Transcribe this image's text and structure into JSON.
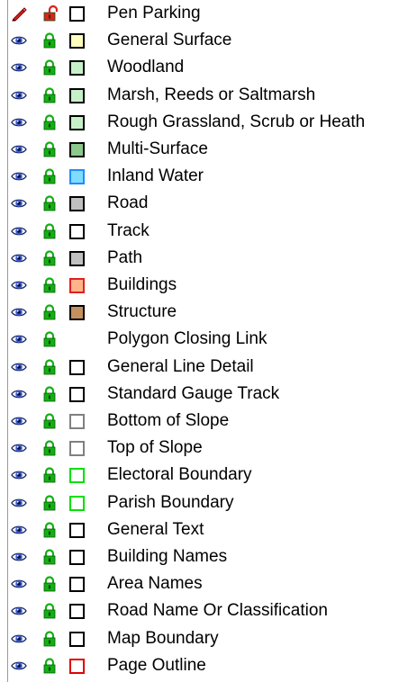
{
  "layers": [
    {
      "name": "Pen Parking",
      "mode": "edit",
      "swatch": {
        "fill": "#ffffff",
        "border": "#000000"
      }
    },
    {
      "name": "General Surface",
      "mode": "view",
      "swatch": {
        "fill": "#ffffc0",
        "border": "#000000"
      }
    },
    {
      "name": "Woodland",
      "mode": "view",
      "swatch": {
        "fill": "#c8f0c8",
        "border": "#000000"
      }
    },
    {
      "name": "Marsh, Reeds or Saltmarsh",
      "mode": "view",
      "swatch": {
        "fill": "#c8f0c8",
        "border": "#000000"
      }
    },
    {
      "name": "Rough Grassland, Scrub or Heath",
      "mode": "view",
      "swatch": {
        "fill": "#c8f0c8",
        "border": "#000000"
      }
    },
    {
      "name": "Multi-Surface",
      "mode": "view",
      "swatch": {
        "fill": "#8cc88c",
        "border": "#000000"
      }
    },
    {
      "name": "Inland Water",
      "mode": "view",
      "swatch": {
        "fill": "#80dcff",
        "border": "#1e8cff"
      }
    },
    {
      "name": "Road",
      "mode": "view",
      "swatch": {
        "fill": "#c0c0c0",
        "border": "#000000"
      }
    },
    {
      "name": "Track",
      "mode": "view",
      "swatch": {
        "fill": "#ffffff",
        "border": "#000000"
      }
    },
    {
      "name": "Path",
      "mode": "view",
      "swatch": {
        "fill": "#c0c0c0",
        "border": "#000000"
      }
    },
    {
      "name": "Buildings",
      "mode": "view",
      "swatch": {
        "fill": "#ffb48c",
        "border": "#e02020"
      }
    },
    {
      "name": "Structure",
      "mode": "view",
      "swatch": {
        "fill": "#c49060",
        "border": "#000000"
      }
    },
    {
      "name": "Polygon Closing Link",
      "mode": "view",
      "swatch": null
    },
    {
      "name": "General Line Detail",
      "mode": "view",
      "swatch": {
        "fill": "#ffffff",
        "border": "#000000"
      }
    },
    {
      "name": "Standard Gauge Track",
      "mode": "view",
      "swatch": {
        "fill": "#ffffff",
        "border": "#000000"
      }
    },
    {
      "name": "Bottom of Slope",
      "mode": "view",
      "swatch": {
        "fill": "#ffffff",
        "border": "#808080"
      }
    },
    {
      "name": "Top of Slope",
      "mode": "view",
      "swatch": {
        "fill": "#ffffff",
        "border": "#808080"
      }
    },
    {
      "name": "Electoral Boundary",
      "mode": "view",
      "swatch": {
        "fill": "#ffffff",
        "border": "#00e000"
      }
    },
    {
      "name": "Parish Boundary",
      "mode": "view",
      "swatch": {
        "fill": "#ffffff",
        "border": "#00e000"
      }
    },
    {
      "name": "General Text",
      "mode": "view",
      "swatch": {
        "fill": "#ffffff",
        "border": "#000000"
      }
    },
    {
      "name": "Building Names",
      "mode": "view",
      "swatch": {
        "fill": "#ffffff",
        "border": "#000000"
      }
    },
    {
      "name": "Area Names",
      "mode": "view",
      "swatch": {
        "fill": "#ffffff",
        "border": "#000000"
      }
    },
    {
      "name": "Road Name Or Classification",
      "mode": "view",
      "swatch": {
        "fill": "#ffffff",
        "border": "#000000"
      }
    },
    {
      "name": "Map Boundary",
      "mode": "view",
      "swatch": {
        "fill": "#ffffff",
        "border": "#000000"
      }
    },
    {
      "name": "Page Outline",
      "mode": "view",
      "swatch": {
        "fill": "#ffffff",
        "border": "#e00000"
      }
    }
  ],
  "icons": {
    "edit": "pencil-icon",
    "view": "eye-icon",
    "locked": "padlock-locked-icon",
    "unlocked": "padlock-unlocked-icon"
  }
}
